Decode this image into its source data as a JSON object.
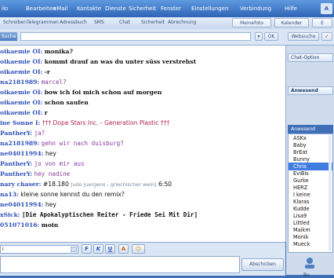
{
  "menubar": {
    "items": [
      "ilo",
      "Bearbeiten",
      "eMail",
      "Kontakte",
      "Dienste",
      "Sicherheit",
      "Fenster",
      "Einstellungen",
      "Verbindung",
      "Hilfe"
    ],
    "logo_text": "A"
  },
  "tabbar": {
    "tabs": [
      "Schreiben",
      "Telegrammen",
      "Adressbuch",
      "SMS",
      "Chat",
      "Sicherheit",
      "Abrechnung"
    ],
    "right_tabs": [
      "Meinefoto",
      "Kalender"
    ],
    "right_tab3_icon": "E"
  },
  "address": {
    "label": "Suche",
    "value": "",
    "ok_label": "OK",
    "webcam_label": "Websuche",
    "check_icon": "✓"
  },
  "chat": {
    "lines": [
      {
        "nick": "oikaemie OI:",
        "text": "monika?",
        "style": "msg"
      },
      {
        "nick": "oikaemie OI:",
        "text": "kommt drauf an was du unter süss verstrehst",
        "style": "msg"
      },
      {
        "nick": "oikaemie OI:",
        "text": "-r",
        "style": "msg"
      },
      {
        "nick": "na2181989:",
        "text": "marcel?",
        "style": "msgp"
      },
      {
        "nick": "oikaemie OI:",
        "text": "bow ich foi mich schon auf morgen",
        "style": "msg"
      },
      {
        "nick": "oikaemie OI:",
        "text": "schon saufen",
        "style": "msg"
      },
      {
        "nick": "oikaemie OI:",
        "text": "r",
        "style": "msg"
      },
      {
        "nick": "ine Sonne I:",
        "text": "††† Dope Stars Inc. - Generation Plastic †††",
        "style": "dj"
      },
      {
        "nick": "PantherY:",
        "text": "ja?",
        "style": "msgp"
      },
      {
        "nick": "na2181989:",
        "text": "gehn wir nach duisburg?",
        "style": "msgp"
      },
      {
        "nick": "ne04011994:",
        "text": "hey",
        "style": "msgplain"
      },
      {
        "nick": "PantherY:",
        "text": "jo von mir aus",
        "style": "msgp"
      },
      {
        "nick": "PantherY:",
        "text": "hey nadine",
        "style": "msgp"
      },
      {
        "nick": "nary chaser:",
        "text": "#18.180",
        "extra": "[udo juergens - griechischer wein]",
        "extra2": "6:50",
        "style": "msgplain"
      },
      {
        "nick": "na13:",
        "text": "kleine sonne kennst du den remix?",
        "style": "msgplain"
      },
      {
        "nick": "ne04011994:",
        "text": "hey",
        "style": "msgplain"
      },
      {
        "nick": "xSick:",
        "text": "[Die Apokalyptischen Reiter - Friede Sei Mit Dir]",
        "style": "msgbig"
      },
      {
        "nick": "051071016:",
        "text": "moin",
        "style": "msg"
      }
    ]
  },
  "right": {
    "options_label": "Chat-Option",
    "present_label": "Anwesend",
    "present_list_label": "Anwesend",
    "users": [
      "ASKx",
      "Baby",
      "BrEat",
      "Bunny",
      "Chris",
      "EviBis",
      "Gurke",
      "HERZ",
      "I keine",
      "Klaras",
      "Kudde",
      "Lisa9",
      "Littled",
      "Maikm",
      "Monik",
      "Mueck"
    ],
    "selected_index": 4,
    "side_label": "Bu"
  },
  "input": {
    "nick_value": "i",
    "fmt_buttons": [
      "F",
      "K",
      "U",
      "A",
      "☺"
    ],
    "send_label": "Abschicken"
  }
}
